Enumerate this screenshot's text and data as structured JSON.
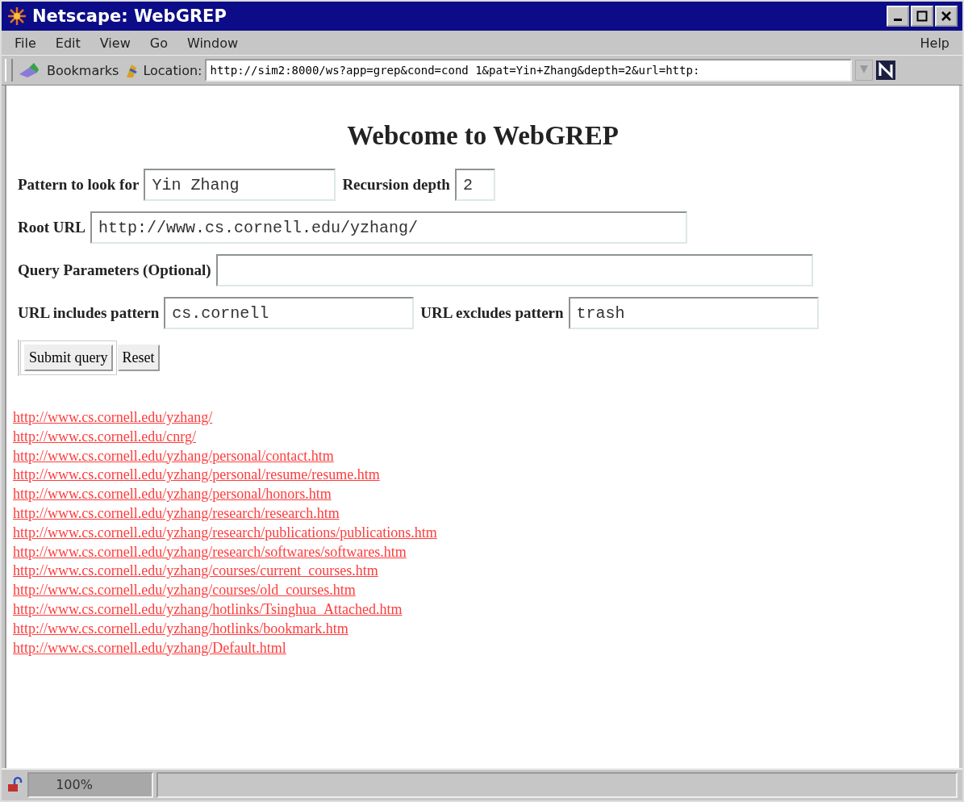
{
  "window": {
    "title": "Netscape: WebGREP"
  },
  "menu": {
    "items": [
      "File",
      "Edit",
      "View",
      "Go",
      "Window"
    ],
    "help": "Help"
  },
  "toolbar": {
    "bookmarks": "Bookmarks",
    "location_label": "Location:",
    "location": "http://sim2:8000/ws?app=grep&cond=cond_1&pat=Yin+Zhang&depth=2&url=http:"
  },
  "page": {
    "heading": "Webcome to WebGREP",
    "rows": [
      [
        {
          "label": "Pattern to look for",
          "value": "Yin Zhang"
        },
        {
          "label": "Recursion depth",
          "value": "2"
        }
      ],
      [
        {
          "label": "Root URL",
          "value": "http://www.cs.cornell.edu/yzhang/"
        }
      ],
      [
        {
          "label": "Query Parameters (Optional)"
        }
      ],
      [
        {
          "label": "URL includes pattern",
          "value": "cs.cornell"
        },
        {
          "label": "URL excludes pattern",
          "value": "trash"
        }
      ]
    ],
    "buttons": [
      "Submit query",
      "Reset"
    ],
    "links": [
      "http://www.cs.cornell.edu/yzhang/",
      "http://www.cs.cornell.edu/cnrg/",
      "http://www.cs.cornell.edu/yzhang/personal/contact.htm",
      "http://www.cs.cornell.edu/yzhang/personal/resume/resume.htm",
      "http://www.cs.cornell.edu/yzhang/personal/honors.htm",
      "http://www.cs.cornell.edu/yzhang/research/research.htm",
      "http://www.cs.cornell.edu/yzhang/research/publications/publications.htm",
      "http://www.cs.cornell.edu/yzhang/research/softwares/softwares.htm",
      "http://www.cs.cornell.edu/yzhang/courses/current_courses.htm",
      "http://www.cs.cornell.edu/yzhang/courses/old_courses.htm",
      "http://www.cs.cornell.edu/yzhang/hotlinks/Tsinghua_Attached.htm",
      "http://www.cs.cornell.edu/yzhang/hotlinks/bookmark.htm",
      "http://www.cs.cornell.edu/yzhang/Default.html"
    ]
  },
  "status_bar": {
    "progress": "100%",
    "level": 1
  }
}
